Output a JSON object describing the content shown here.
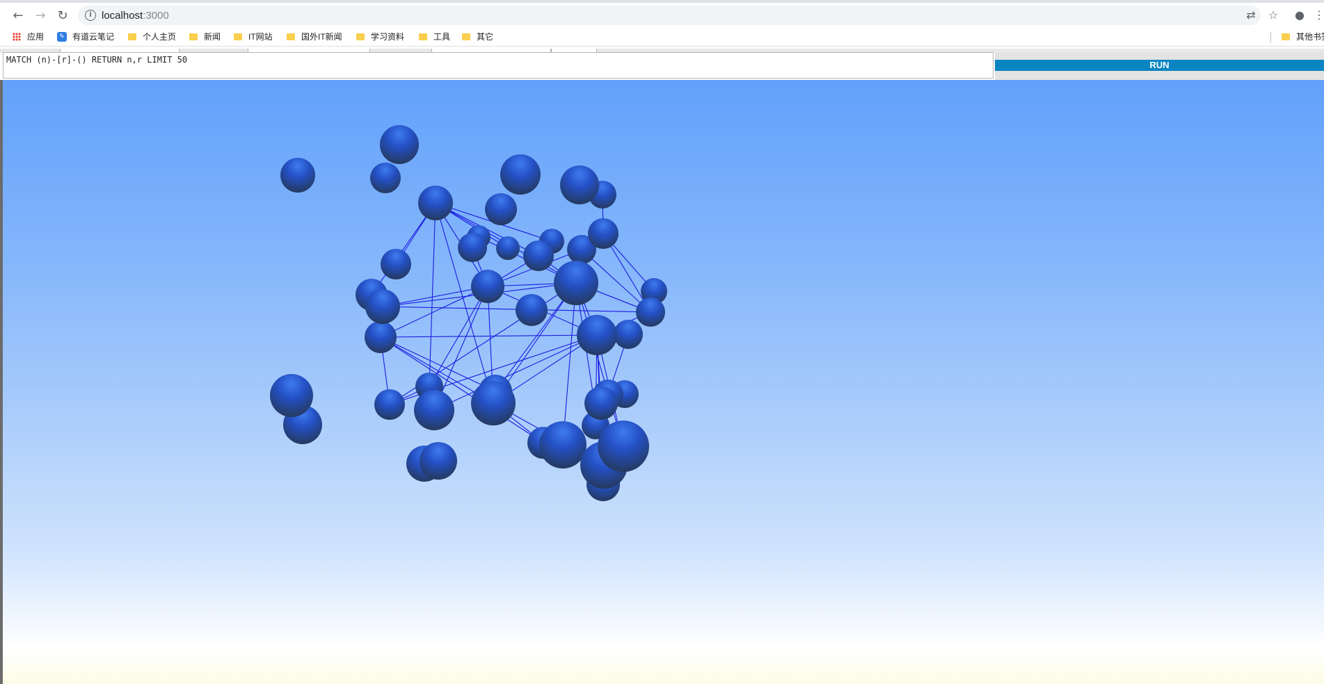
{
  "browser": {
    "url_host": "localhost",
    "url_port": ":3000",
    "bookmarks": [
      {
        "label": "应用",
        "kind": "apps"
      },
      {
        "label": "有道云笔记",
        "kind": "note"
      },
      {
        "label": "个人主页",
        "kind": "folder"
      },
      {
        "label": "新闻",
        "kind": "folder"
      },
      {
        "label": "IT网站",
        "kind": "folder"
      },
      {
        "label": "国外IT新闻",
        "kind": "folder"
      },
      {
        "label": "学习资料",
        "kind": "folder"
      },
      {
        "label": "工具",
        "kind": "folder"
      },
      {
        "label": "其它",
        "kind": "folder"
      }
    ],
    "other_bookmarks_label": "其他书签"
  },
  "query": {
    "text": "MATCH (n)-[r]-() RETURN n,r LIMIT 50",
    "run_label": "RUN"
  },
  "graph": {
    "node_color": "#2050c8",
    "edge_color": "#1a1ae0",
    "node_count": 50
  }
}
